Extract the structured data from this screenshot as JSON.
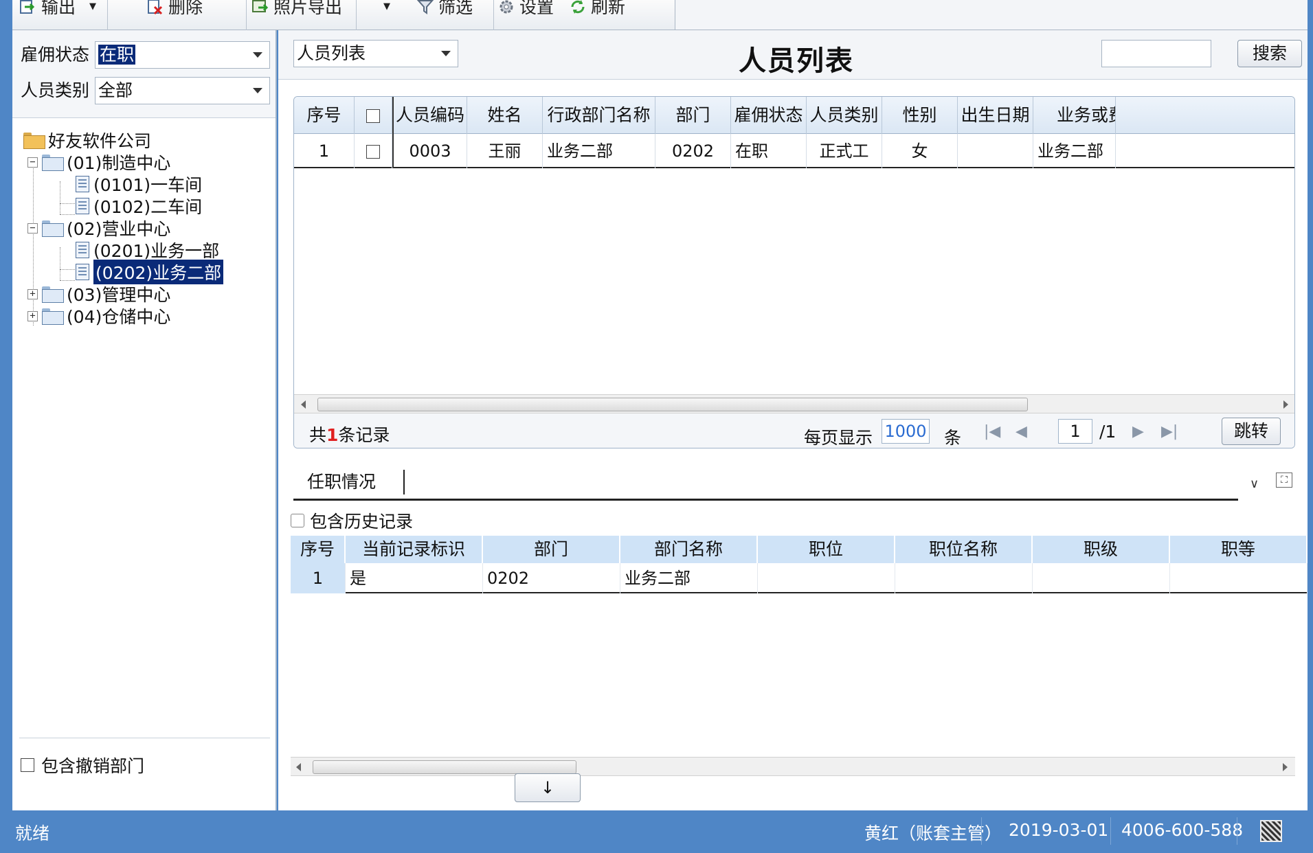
{
  "toolbar": {
    "items": [
      {
        "label": "输出",
        "icon": "export-icon"
      },
      {
        "label": "删除",
        "icon": "delete-icon"
      },
      {
        "label": "照片导出",
        "icon": "photo-export-icon"
      },
      {
        "label": "筛选",
        "icon": "filter-icon"
      },
      {
        "label": "设置",
        "icon": "gear-icon"
      },
      {
        "label": "刷新",
        "icon": "refresh-icon"
      }
    ]
  },
  "filters": {
    "employment_label": "雇佣状态",
    "employment_value": "在职",
    "category_label": "人员类别",
    "category_value": "全部"
  },
  "tree": {
    "root": "好友软件公司",
    "nodes": [
      "(01)制造中心",
      "(0101)一车间",
      "(0102)二车间",
      "(02)营业中心",
      "(0201)业务一部",
      "(0202)业务二部",
      "(03)管理中心",
      "(04)仓储中心"
    ],
    "include_revoked_label": "包含撤销部门"
  },
  "main": {
    "view_select": "人员列表",
    "title": "人员列表",
    "search_label": "搜索"
  },
  "grid": {
    "columns": [
      "序号",
      "",
      "人员编码",
      "姓名",
      "行政部门名称",
      "部门",
      "雇佣状态",
      "人员类别",
      "性别",
      "出生日期",
      "业务或费"
    ],
    "rows": [
      [
        "1",
        "",
        "0003",
        "王丽",
        "业务二部",
        "0202",
        "在职",
        "正式工",
        "女",
        "",
        "业务二部"
      ]
    ]
  },
  "pager": {
    "total_prefix": "共",
    "total_count": "1",
    "total_suffix": "条记录",
    "per_page_label": "每页显示",
    "per_page_value": "1000",
    "per_page_unit": "条",
    "page_current": "1",
    "page_total": "/1",
    "jump_label": "跳转"
  },
  "subsection": {
    "tab_label": "任职情况",
    "history_label": "包含历史记录",
    "columns": [
      "序号",
      "当前记录标识",
      "部门",
      "部门名称",
      "职位",
      "职位名称",
      "职级",
      "职等"
    ],
    "rows": [
      [
        "1",
        "是",
        "0202",
        "业务二部",
        "",
        "",
        "",
        ""
      ]
    ],
    "down_button": "↓"
  },
  "status": {
    "ready": "就绪",
    "user": "黄红（账套主管）",
    "date": "2019-03-01",
    "phone": "4006-600-588"
  }
}
